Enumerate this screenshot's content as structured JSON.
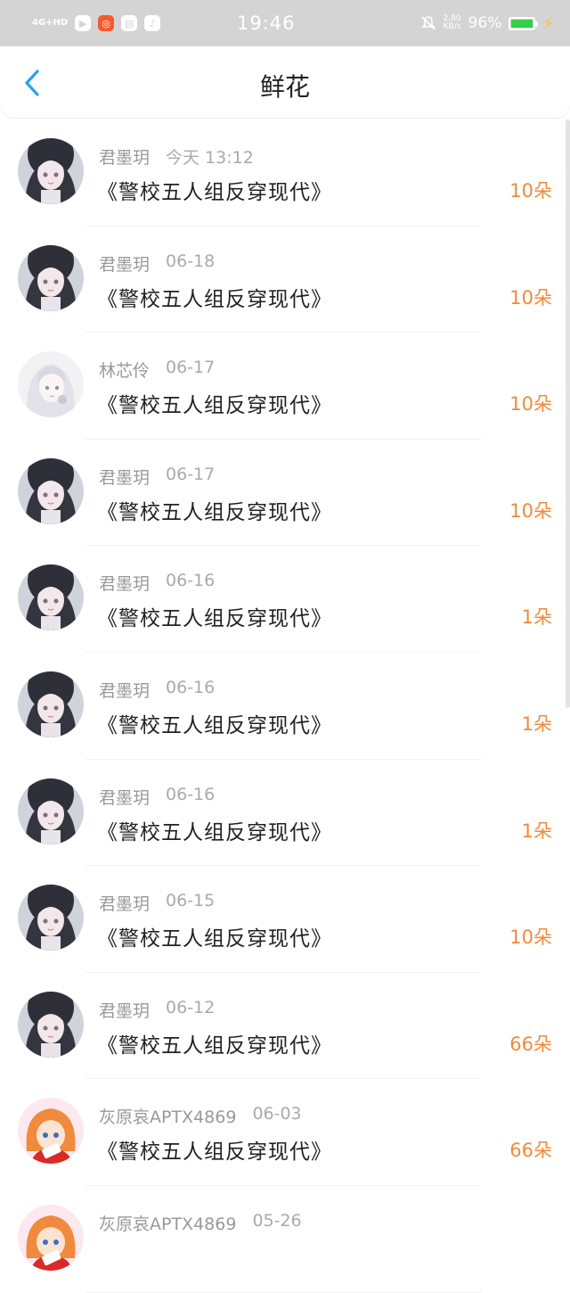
{
  "status_bar": {
    "network": "4G+HD",
    "time": "19:46",
    "speed_value": "2.80",
    "speed_unit": "KB/s",
    "battery_percent": "96%"
  },
  "header": {
    "title": "鲜花"
  },
  "colors": {
    "accent": "#2aa0f2",
    "count": "#f08a3c",
    "status_bar_bg": "#d4d4d4",
    "battery": "#35d04a"
  },
  "records": [
    {
      "user": "君墨玥",
      "date": "今天 13:12",
      "book": "《警校五人组反穿现代》",
      "count": "10朵",
      "avatar": "dark-hair"
    },
    {
      "user": "君墨玥",
      "date": "06-18",
      "book": "《警校五人组反穿现代》",
      "count": "10朵",
      "avatar": "dark-hair"
    },
    {
      "user": "林芯伶",
      "date": "06-17",
      "book": "《警校五人组反穿现代》",
      "count": "10朵",
      "avatar": "silver-hair"
    },
    {
      "user": "君墨玥",
      "date": "06-17",
      "book": "《警校五人组反穿现代》",
      "count": "10朵",
      "avatar": "dark-hair"
    },
    {
      "user": "君墨玥",
      "date": "06-16",
      "book": "《警校五人组反穿现代》",
      "count": "1朵",
      "avatar": "dark-hair"
    },
    {
      "user": "君墨玥",
      "date": "06-16",
      "book": "《警校五人组反穿现代》",
      "count": "1朵",
      "avatar": "dark-hair"
    },
    {
      "user": "君墨玥",
      "date": "06-16",
      "book": "《警校五人组反穿现代》",
      "count": "1朵",
      "avatar": "dark-hair"
    },
    {
      "user": "君墨玥",
      "date": "06-15",
      "book": "《警校五人组反穿现代》",
      "count": "10朵",
      "avatar": "dark-hair"
    },
    {
      "user": "君墨玥",
      "date": "06-12",
      "book": "《警校五人组反穿现代》",
      "count": "66朵",
      "avatar": "dark-hair"
    },
    {
      "user": "灰原哀APTX4869",
      "date": "06-03",
      "book": "《警校五人组反穿现代》",
      "count": "66朵",
      "avatar": "orange-hair"
    },
    {
      "user": "灰原哀APTX4869",
      "date": "05-26",
      "book": "",
      "count": "",
      "avatar": "orange-hair"
    }
  ]
}
